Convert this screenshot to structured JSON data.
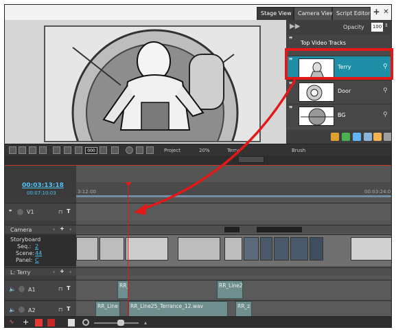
{
  "tabs": [
    {
      "label": "Stage View",
      "active": true
    },
    {
      "label": "Camera View",
      "active": false
    },
    {
      "label": "Script Editor",
      "active": false
    }
  ],
  "tab_controls": {
    "add": "+",
    "close": "✕"
  },
  "layers_panel": {
    "opacity_label": "Opacity",
    "opacity_value": "100",
    "title": "Top Video Tracks",
    "tracks": [
      {
        "label": "Terry",
        "selected": true
      },
      {
        "label": "Door",
        "selected": false
      },
      {
        "label": "BG",
        "selected": false
      }
    ]
  },
  "stage_toolbar": {
    "project_label": "Project",
    "zoom_value": "20%",
    "layer_value": "Terry",
    "tool_label": "Brush",
    "counter": "000"
  },
  "timecode": {
    "current": "00:03:13:18",
    "total": "00:07:10:03"
  },
  "ruler": {
    "left": "3:12:00",
    "right": "00:03:24:0"
  },
  "tracks_left": {
    "v1": "V1",
    "camera": "Camera",
    "storyboard": "Storyboard",
    "seq_label": "Seq.:",
    "seq_value": "2",
    "scene_label": "Scene:",
    "scene_value": "44",
    "panel_label": "Panel:",
    "panel_value": "C",
    "layer_label": "L: Terry",
    "a1": "A1",
    "a2": "A2"
  },
  "audio_clips": {
    "a1": [
      "RR_",
      "RR_Line2"
    ],
    "a2": [
      "RR_Line",
      "RR_Line25_Terrance_12.wav",
      "RR_z"
    ]
  },
  "colors": {
    "accent": "#1e8fa6",
    "highlight": "#e31919",
    "link": "#4fc3f7"
  }
}
